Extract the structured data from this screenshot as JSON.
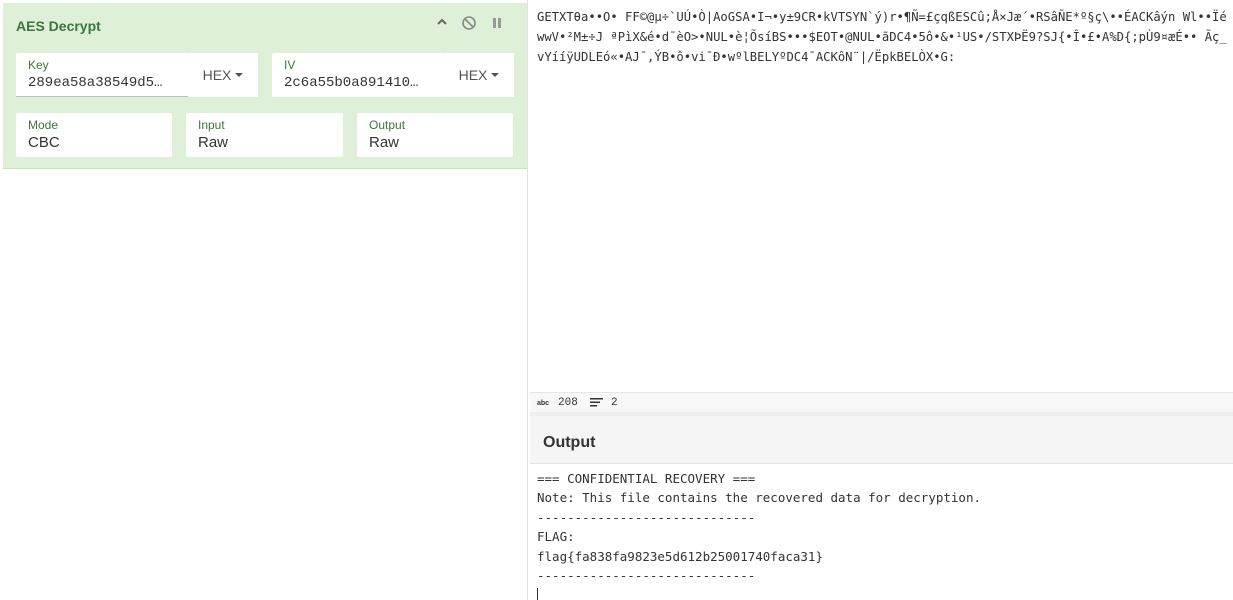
{
  "recipe": {
    "title": "AES Decrypt",
    "key": {
      "label": "Key",
      "value": "289ea58a38549d5…",
      "format": "HEX"
    },
    "iv": {
      "label": "IV",
      "value": "2c6a55b0a891410…",
      "format": "HEX"
    },
    "mode": {
      "label": "Mode",
      "value": "CBC"
    },
    "input": {
      "label": "Input",
      "value": "Raw"
    },
    "output": {
      "label": "Output",
      "value": "Raw"
    }
  },
  "input_pane": {
    "text": "GETXTθa••O• FF©@µ÷`UÚ•Ò|AoGSA•I¬•y±9CR•kVTSYN`ý)r•¶Ñ=£çqßESCû;Å×Jæ´•RSâÑE*º§ç\\••ÉACKâýn Wl••ÏéwwV•²M±÷J ªPìX&é•d¯èO>•NUL•è¦ÕsíBS•••$EOT•@NUL•ãDC4•5ô•&•¹US•/STXÞË9?SJ{•Î•£•A%D{;pÙ9¤æÉ•• Ãç_vYííÿUDLEó«•AJ¯,ÝB•ô•vi¯Ð•wºlBELYºDC4¯ACKôN¨|/ËpkBELÒX•G:",
    "length": "208",
    "lines": "2"
  },
  "output_pane": {
    "title": "Output",
    "lines": [
      "=== CONFIDENTIAL RECOVERY ===",
      "Note: This file contains the recovered data for decryption.",
      "-----------------------------",
      "FLAG:",
      "flag{fa838fa9823e5d612b25001740faca31}",
      "-----------------------------"
    ]
  },
  "icons": [
    "chevron-up-icon",
    "disable-icon",
    "pause-icon",
    "text-length-icon",
    "lines-icon"
  ]
}
